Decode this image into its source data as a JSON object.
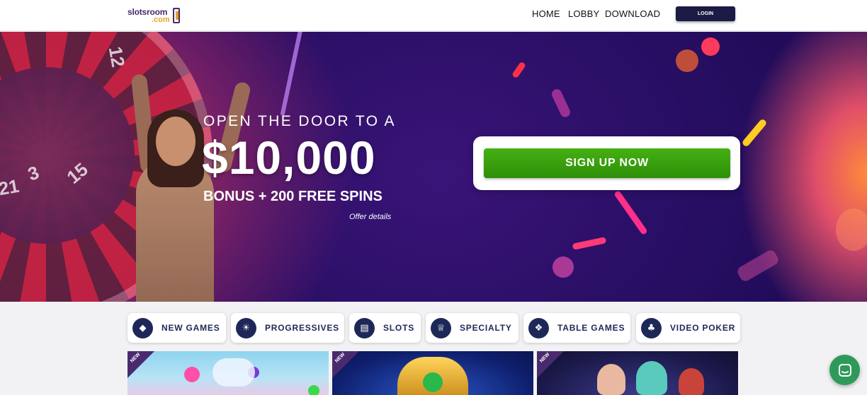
{
  "header": {
    "logo_line1": "slotsroom",
    "logo_line2": ".com",
    "nav": [
      "HOME",
      "LOBBY",
      "DOWNLOAD"
    ],
    "login_label": "LOGIN"
  },
  "hero": {
    "line1": "OPEN THE DOOR TO A",
    "amount": "$10,000",
    "line3": "BONUS + 200 FREE SPINS",
    "offer_details": "Offer details",
    "signup_label": "SIGN UP NOW",
    "wheel_numbers": [
      "12",
      "3",
      "15",
      "21"
    ]
  },
  "categories": [
    {
      "label": "NEW GAMES",
      "icon": "diamond-icon"
    },
    {
      "label": "PROGRESSIVES",
      "icon": "sun-icon"
    },
    {
      "label": "SLOTS",
      "icon": "slot-machine-icon"
    },
    {
      "label": "SPECIALTY",
      "icon": "crown-icon"
    },
    {
      "label": "TABLE GAMES",
      "icon": "chips-icon"
    },
    {
      "label": "VIDEO POKER",
      "icon": "cards-icon"
    }
  ],
  "tiles": [
    {
      "badge": "NEW"
    },
    {
      "badge": "NEW"
    },
    {
      "badge": "NEW"
    }
  ],
  "colors": {
    "nav_dark": "#1b1b45",
    "signup_green": "#3aa20e",
    "category_navy": "#1e2858",
    "badge_purple": "#4a2a6e",
    "chat_green": "#2e9a5a"
  }
}
